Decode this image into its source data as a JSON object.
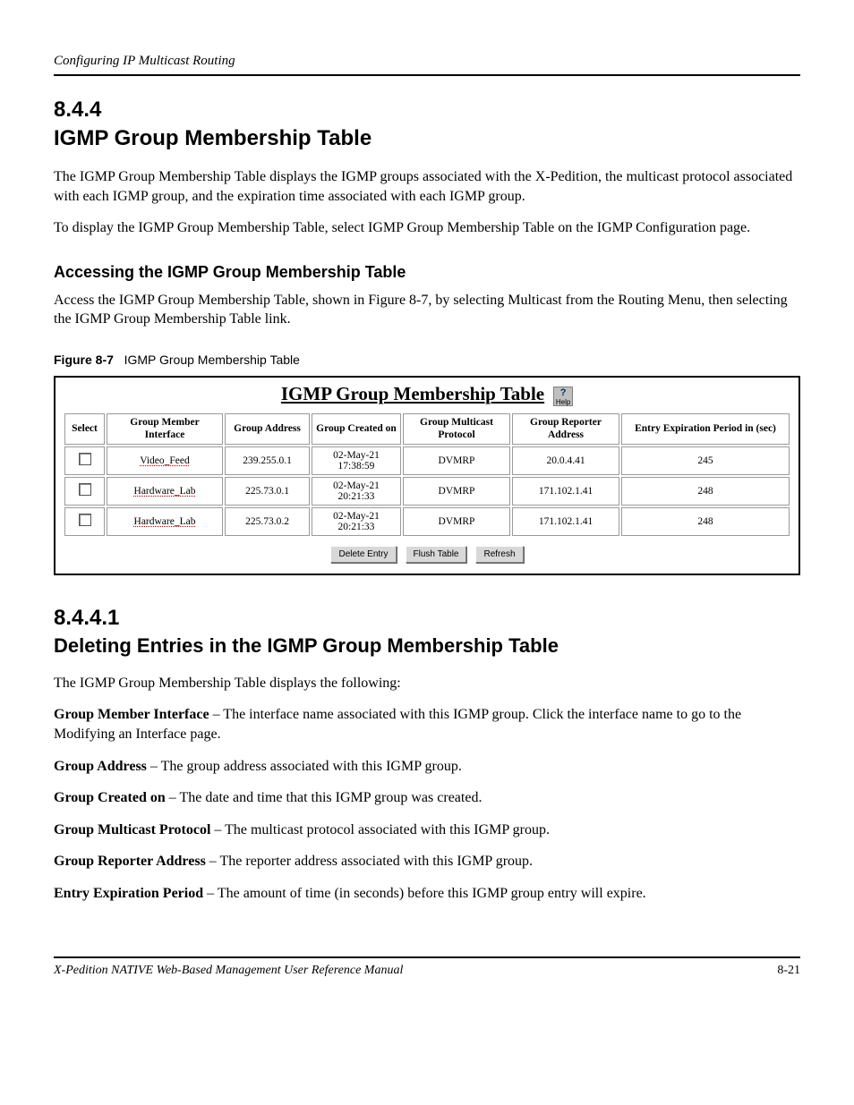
{
  "running_head": "Configuring IP Multicast Routing",
  "section": {
    "number": "8.4.4",
    "title": "IGMP Group Membership Table",
    "p1": "The IGMP Group Membership Table displays the IGMP groups associated with the X-Pedition, the multicast protocol associated with each IGMP group, and the expiration time associated with each IGMP group.",
    "p2": "To display the IGMP Group Membership Table, select IGMP Group Membership Table on the IGMP Configuration page.",
    "access_head": "Accessing the IGMP Group Membership Table",
    "access_p": "Access the IGMP Group Membership Table, shown in Figure 8-7, by selecting Multicast from the Routing Menu, then selecting the IGMP Group Membership Table link.",
    "fig_label": "Figure 8-7",
    "fig_title": "IGMP Group Membership Table"
  },
  "panel": {
    "title": "IGMP Group Membership Table",
    "help_label": "Help",
    "headers": {
      "select": "Select",
      "iface": "Group Member Interface",
      "addr": "Group Address",
      "created": "Group Created on",
      "proto": "Group Multicast Protocol",
      "reporter": "Group Reporter Address",
      "expire": "Entry Expiration Period in (sec)"
    },
    "rows": [
      {
        "iface": "Video_Feed",
        "addr": "239.255.0.1",
        "created_l1": "02-May-21",
        "created_l2": "17:38:59",
        "proto": "DVMRP",
        "reporter": "20.0.4.41",
        "expire": "245"
      },
      {
        "iface": "Hardware_Lab",
        "addr": "225.73.0.1",
        "created_l1": "02-May-21",
        "created_l2": "20:21:33",
        "proto": "DVMRP",
        "reporter": "171.102.1.41",
        "expire": "248"
      },
      {
        "iface": "Hardware_Lab",
        "addr": "225.73.0.2",
        "created_l1": "02-May-21",
        "created_l2": "20:21:33",
        "proto": "DVMRP",
        "reporter": "171.102.1.41",
        "expire": "248"
      }
    ],
    "buttons": {
      "delete": "Delete Entry",
      "flush": "Flush Table",
      "refresh": "Refresh"
    }
  },
  "section2": {
    "number": "8.4.4.1",
    "title": "Deleting Entries in the IGMP Group Membership Table",
    "lead": "The IGMP Group Membership Table displays the following:",
    "items": [
      {
        "term": "Group Member Interface",
        "desc": " – The interface name associated with this IGMP group. Click the interface name to go to the Modifying an Interface page."
      },
      {
        "term": "Group Address",
        "desc": " – The group address associated with this IGMP group."
      },
      {
        "term": "Group Created on",
        "desc": " – The date and time that this IGMP group was created."
      },
      {
        "term": "Group Multicast Protocol",
        "desc": " – The multicast protocol associated with this IGMP group."
      },
      {
        "term": "Group Reporter Address",
        "desc": " – The reporter address associated with this IGMP group."
      },
      {
        "term": "Entry Expiration Period",
        "desc": " – The amount of time (in seconds) before this IGMP group entry will expire."
      }
    ]
  },
  "footer": {
    "left": "X-Pedition NATIVE Web-Based Management User Reference Manual",
    "right": "8-21"
  }
}
